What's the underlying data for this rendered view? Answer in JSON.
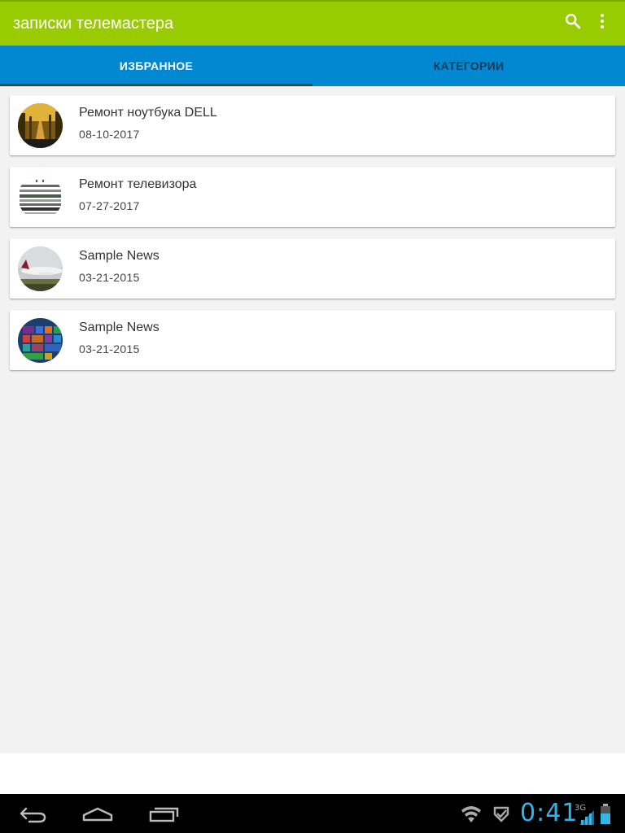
{
  "app": {
    "title": "записки телемастера"
  },
  "icons": {
    "search": "search-icon",
    "overflow": "more-vert-icon"
  },
  "tabs": [
    {
      "label": "ИЗБРАННОЕ",
      "active": true
    },
    {
      "label": "КАТЕГОРИИ",
      "active": false
    }
  ],
  "items": [
    {
      "title": "Ремонт ноутбука DELL",
      "date": "08-10-2017",
      "thumb": "forest-road-photo"
    },
    {
      "title": "Ремонт телевизора",
      "date": "07-27-2017",
      "thumb": "schematic-screenshot"
    },
    {
      "title": "Sample News",
      "date": "03-21-2015",
      "thumb": "airplane-photo"
    },
    {
      "title": "Sample News",
      "date": "03-21-2015",
      "thumb": "windows-tiles-screenshot"
    }
  ],
  "status": {
    "time": "0:41",
    "network": "3G"
  },
  "colors": {
    "app_bar": "#99cc00",
    "tab_bar": "#0288d1",
    "indicator": "#1a5230",
    "clock": "#33b5e5"
  }
}
